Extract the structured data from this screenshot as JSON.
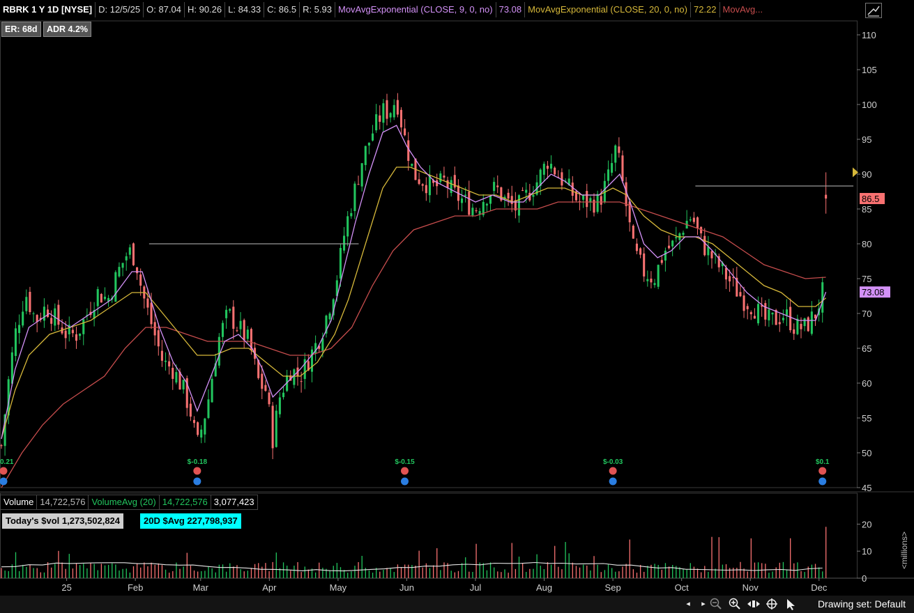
{
  "header": {
    "symbol": "RBRK 1 Y 1D [NYSE]",
    "date": "D: 12/5/25",
    "open": "O: 87.04",
    "high": "H: 90.26",
    "low": "L: 84.33",
    "close": "C: 86.5",
    "range": "R: 5.93",
    "ema9_label": "MovAvgExponential (CLOSE, 9, 0, no)",
    "ema9_value": "73.08",
    "ema20_label": "MovAvgExponential (CLOSE, 20, 0, no)",
    "ema20_value": "72.22",
    "ema50_label": "MovAvg..."
  },
  "badges": {
    "er": "ER: 68d",
    "adr": "ADR 4.2%"
  },
  "price_tags": {
    "last": "86.5",
    "ema9": "73.08"
  },
  "earnings": [
    {
      "label": "$-0.18",
      "month": 1.95
    },
    {
      "label": "$-0.15",
      "month": 4.97
    },
    {
      "label": "$-0.03",
      "month": 8.0
    },
    {
      "label": "$0.1",
      "month": 11.05
    }
  ],
  "earnings_partial": "0.21",
  "volume_header": {
    "label": "Volume",
    "value": "14,722,576",
    "avg_label": "VolumeAvg (20)",
    "avg_value": "14,722,576",
    "extra": "3,077,423"
  },
  "dollar_volume": {
    "today": "Today's $vol 1,273,502,824",
    "avg20": "20D $Avg 227,798,937"
  },
  "volume_unit": "<millions>",
  "footer": {
    "drawing_set": "Drawing set: Default"
  },
  "colors": {
    "up": "#22c55e",
    "down": "#f87171",
    "ema9": "#d391f7",
    "ema20": "#d6b83a",
    "ema50": "#c74d4d",
    "aqua": "#00ffff"
  },
  "chart_data": {
    "type": "candlestick",
    "price_axis": {
      "ylim": [
        45,
        112
      ],
      "ticks": [
        45,
        50,
        55,
        60,
        65,
        70,
        75,
        80,
        85,
        90,
        95,
        100,
        105,
        110
      ]
    },
    "volume_axis": {
      "ylim": [
        0,
        25
      ],
      "ticks": [
        0,
        10,
        20
      ],
      "unit": "millions"
    },
    "x_ticks": [
      "25",
      "Feb",
      "Mar",
      "Apr",
      "May",
      "Jun",
      "Jul",
      "Aug",
      "Sep",
      "Oct",
      "Nov",
      "Dec"
    ],
    "x_tick_month_index": [
      0.05,
      1.05,
      2.0,
      3.0,
      4.0,
      5.0,
      6.0,
      7.0,
      8.0,
      9.0,
      10.0,
      11.0
    ],
    "x_range_months": [
      -0.92,
      11.55
    ],
    "close_points": [
      [
        -0.9,
        51
      ],
      [
        -0.8,
        60
      ],
      [
        -0.7,
        67
      ],
      [
        -0.55,
        73
      ],
      [
        -0.4,
        69
      ],
      [
        -0.25,
        71
      ],
      [
        -0.1,
        69
      ],
      [
        0.05,
        67
      ],
      [
        0.2,
        67
      ],
      [
        0.35,
        70
      ],
      [
        0.5,
        73
      ],
      [
        0.65,
        72
      ],
      [
        0.8,
        76
      ],
      [
        0.95,
        79
      ],
      [
        1.05,
        78
      ],
      [
        1.15,
        73
      ],
      [
        1.3,
        68
      ],
      [
        1.45,
        63
      ],
      [
        1.6,
        62
      ],
      [
        1.75,
        59
      ],
      [
        1.85,
        56
      ],
      [
        1.95,
        51
      ],
      [
        2.1,
        57
      ],
      [
        2.25,
        66
      ],
      [
        2.4,
        70
      ],
      [
        2.55,
        68
      ],
      [
        2.7,
        66
      ],
      [
        2.85,
        60
      ],
      [
        2.95,
        59
      ],
      [
        3.05,
        52
      ],
      [
        3.15,
        58
      ],
      [
        3.3,
        62
      ],
      [
        3.45,
        61
      ],
      [
        3.6,
        64
      ],
      [
        3.75,
        67
      ],
      [
        3.9,
        72
      ],
      [
        4.0,
        76
      ],
      [
        4.1,
        82
      ],
      [
        4.2,
        86
      ],
      [
        4.35,
        92
      ],
      [
        4.5,
        96
      ],
      [
        4.65,
        99
      ],
      [
        4.75,
        99
      ],
      [
        4.85,
        101
      ],
      [
        4.95,
        96
      ],
      [
        5.1,
        90
      ],
      [
        5.25,
        89
      ],
      [
        5.4,
        88
      ],
      [
        5.55,
        89
      ],
      [
        5.7,
        87
      ],
      [
        5.85,
        86
      ],
      [
        6.0,
        85
      ],
      [
        6.15,
        87
      ],
      [
        6.3,
        88
      ],
      [
        6.45,
        86
      ],
      [
        6.6,
        85
      ],
      [
        6.75,
        87
      ],
      [
        6.9,
        89
      ],
      [
        7.05,
        92
      ],
      [
        7.2,
        90
      ],
      [
        7.35,
        88
      ],
      [
        7.5,
        86
      ],
      [
        7.65,
        86
      ],
      [
        7.8,
        86
      ],
      [
        7.95,
        90
      ],
      [
        8.05,
        94
      ],
      [
        8.15,
        88
      ],
      [
        8.3,
        79
      ],
      [
        8.45,
        76
      ],
      [
        8.6,
        75
      ],
      [
        8.75,
        79
      ],
      [
        8.9,
        80
      ],
      [
        9.05,
        83
      ],
      [
        9.15,
        84
      ],
      [
        9.3,
        80
      ],
      [
        9.45,
        78
      ],
      [
        9.6,
        76
      ],
      [
        9.75,
        74
      ],
      [
        9.9,
        72
      ],
      [
        10.05,
        71
      ],
      [
        10.2,
        69
      ],
      [
        10.35,
        69
      ],
      [
        10.5,
        70
      ],
      [
        10.65,
        68
      ],
      [
        10.8,
        68
      ],
      [
        10.95,
        70
      ],
      [
        11.05,
        73
      ],
      [
        11.1,
        86.5
      ]
    ],
    "ema9_points": [
      [
        -0.9,
        52
      ],
      [
        -0.7,
        62
      ],
      [
        -0.5,
        68
      ],
      [
        -0.2,
        70
      ],
      [
        0.1,
        68
      ],
      [
        0.4,
        70
      ],
      [
        0.7,
        72
      ],
      [
        1.0,
        76
      ],
      [
        1.15,
        76
      ],
      [
        1.4,
        68
      ],
      [
        1.6,
        63
      ],
      [
        1.8,
        60
      ],
      [
        1.95,
        56
      ],
      [
        2.15,
        61
      ],
      [
        2.35,
        66
      ],
      [
        2.55,
        67
      ],
      [
        2.75,
        65
      ],
      [
        2.9,
        62
      ],
      [
        3.05,
        58
      ],
      [
        3.25,
        60
      ],
      [
        3.45,
        62
      ],
      [
        3.7,
        65
      ],
      [
        3.9,
        69
      ],
      [
        4.05,
        75
      ],
      [
        4.25,
        83
      ],
      [
        4.45,
        90
      ],
      [
        4.65,
        96
      ],
      [
        4.85,
        97
      ],
      [
        5.0,
        94
      ],
      [
        5.2,
        91
      ],
      [
        5.4,
        89
      ],
      [
        5.6,
        88
      ],
      [
        5.8,
        87
      ],
      [
        6.0,
        86
      ],
      [
        6.25,
        87
      ],
      [
        6.5,
        86
      ],
      [
        6.7,
        86
      ],
      [
        6.9,
        88
      ],
      [
        7.1,
        90
      ],
      [
        7.3,
        89
      ],
      [
        7.55,
        87
      ],
      [
        7.8,
        87
      ],
      [
        8.0,
        89
      ],
      [
        8.1,
        90
      ],
      [
        8.25,
        86
      ],
      [
        8.45,
        80
      ],
      [
        8.65,
        78
      ],
      [
        8.85,
        79
      ],
      [
        9.05,
        81
      ],
      [
        9.25,
        81
      ],
      [
        9.45,
        79
      ],
      [
        9.7,
        76
      ],
      [
        9.95,
        73
      ],
      [
        10.2,
        71
      ],
      [
        10.45,
        70
      ],
      [
        10.7,
        69
      ],
      [
        10.95,
        69
      ],
      [
        11.1,
        73.08
      ]
    ],
    "ema20_points": [
      [
        -0.9,
        52
      ],
      [
        -0.7,
        59
      ],
      [
        -0.5,
        64
      ],
      [
        -0.2,
        67
      ],
      [
        0.1,
        68
      ],
      [
        0.4,
        69
      ],
      [
        0.7,
        71
      ],
      [
        1.0,
        73
      ],
      [
        1.2,
        73
      ],
      [
        1.45,
        70
      ],
      [
        1.7,
        67
      ],
      [
        1.95,
        64
      ],
      [
        2.2,
        64
      ],
      [
        2.45,
        65
      ],
      [
        2.7,
        65
      ],
      [
        2.95,
        63
      ],
      [
        3.2,
        61
      ],
      [
        3.45,
        61
      ],
      [
        3.7,
        63
      ],
      [
        3.95,
        67
      ],
      [
        4.15,
        72
      ],
      [
        4.4,
        80
      ],
      [
        4.65,
        88
      ],
      [
        4.85,
        91
      ],
      [
        5.05,
        91
      ],
      [
        5.3,
        90
      ],
      [
        5.55,
        89
      ],
      [
        5.8,
        88
      ],
      [
        6.05,
        87
      ],
      [
        6.3,
        87
      ],
      [
        6.55,
        86
      ],
      [
        6.8,
        87
      ],
      [
        7.05,
        88
      ],
      [
        7.3,
        88
      ],
      [
        7.55,
        87
      ],
      [
        7.8,
        87
      ],
      [
        8.0,
        88
      ],
      [
        8.2,
        87
      ],
      [
        8.45,
        84
      ],
      [
        8.7,
        82
      ],
      [
        8.95,
        81
      ],
      [
        9.2,
        81
      ],
      [
        9.45,
        80
      ],
      [
        9.7,
        78
      ],
      [
        9.95,
        76
      ],
      [
        10.2,
        74
      ],
      [
        10.45,
        73
      ],
      [
        10.7,
        71
      ],
      [
        10.95,
        71
      ],
      [
        11.1,
        72.22
      ]
    ],
    "ema50_points": [
      [
        -0.9,
        45
      ],
      [
        -0.6,
        50
      ],
      [
        -0.3,
        54
      ],
      [
        0.0,
        57
      ],
      [
        0.3,
        59
      ],
      [
        0.6,
        61
      ],
      [
        0.9,
        65
      ],
      [
        1.2,
        68
      ],
      [
        1.5,
        68
      ],
      [
        1.8,
        67
      ],
      [
        2.1,
        66
      ],
      [
        2.4,
        66
      ],
      [
        2.7,
        66
      ],
      [
        3.0,
        65
      ],
      [
        3.3,
        64
      ],
      [
        3.6,
        64
      ],
      [
        3.9,
        65
      ],
      [
        4.2,
        68
      ],
      [
        4.5,
        74
      ],
      [
        4.8,
        79
      ],
      [
        5.1,
        82
      ],
      [
        5.4,
        83
      ],
      [
        5.7,
        84
      ],
      [
        6.0,
        84
      ],
      [
        6.3,
        85
      ],
      [
        6.6,
        85
      ],
      [
        6.9,
        85
      ],
      [
        7.2,
        86
      ],
      [
        7.5,
        86
      ],
      [
        7.8,
        86
      ],
      [
        8.1,
        86
      ],
      [
        8.4,
        85
      ],
      [
        8.7,
        84
      ],
      [
        9.0,
        83
      ],
      [
        9.3,
        82
      ],
      [
        9.6,
        81
      ],
      [
        9.9,
        79
      ],
      [
        10.2,
        77
      ],
      [
        10.5,
        76
      ],
      [
        10.8,
        75
      ],
      [
        11.1,
        75.2
      ]
    ],
    "resistance_lines": [
      {
        "from": 1.25,
        "to": 4.3,
        "y": 80
      },
      {
        "from": 9.2,
        "to": 11.5,
        "y": 88.3
      }
    ]
  }
}
